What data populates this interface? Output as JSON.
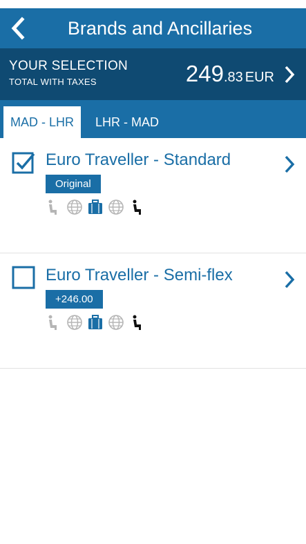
{
  "header": {
    "title": "Brands and Ancillaries"
  },
  "summary": {
    "title": "YOUR SELECTION",
    "subtitle": "TOTAL WITH TAXES",
    "price_int": "249",
    "price_dec": ".83",
    "currency": "EUR"
  },
  "tabs": [
    {
      "label": "MAD - LHR",
      "active": true
    },
    {
      "label": "LHR - MAD",
      "active": false
    }
  ],
  "fares": [
    {
      "title": "Euro Traveller - Standard",
      "badge": "Original",
      "checked": true,
      "icons": [
        "seat-unavailable-icon",
        "globe-icon",
        "baggage-icon",
        "globe-icon",
        "seat-icon"
      ]
    },
    {
      "title": "Euro Traveller - Semi-flex",
      "badge": "+246.00",
      "checked": false,
      "icons": [
        "seat-unavailable-icon",
        "globe-icon",
        "baggage-icon",
        "globe-icon",
        "seat-icon"
      ]
    }
  ],
  "colors": {
    "header": "#1a6ea6",
    "summary": "#0f4a72",
    "accent": "#1a6ea6",
    "divider": "#e1e1e1"
  }
}
